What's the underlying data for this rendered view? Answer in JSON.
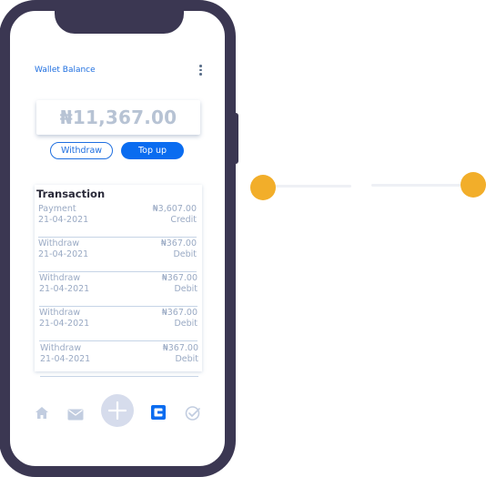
{
  "header": {
    "title": "Wallet Balance",
    "menu_icon": "kebab-menu-icon"
  },
  "balance": {
    "amount": "₦11,367.00"
  },
  "actions": {
    "withdraw_label": "Withdraw",
    "topup_label": "Top up"
  },
  "transactions": {
    "title": "Transaction",
    "items": [
      {
        "type": "Payment",
        "date": "21-04-2021",
        "amount": "₦3,607.00",
        "kind": "Credit"
      },
      {
        "type": "Withdraw",
        "date": "21-04-2021",
        "amount": "₦367.00",
        "kind": "Debit"
      },
      {
        "type": "Withdraw",
        "date": "21-04-2021",
        "amount": "₦367.00",
        "kind": "Debit"
      },
      {
        "type": "Withdraw",
        "date": "21-04-2021",
        "amount": "₦367.00",
        "kind": "Debit"
      },
      {
        "type": "Withdraw",
        "date": "21-04-2021",
        "amount": "₦367.00",
        "kind": "Debit"
      }
    ]
  },
  "tabbar": {
    "icons": [
      "home-icon",
      "mail-icon",
      "plus-icon",
      "wallet-icon",
      "check-badge-icon"
    ],
    "active": "wallet-icon"
  },
  "colors": {
    "accent": "#0a6cf0",
    "phone_frame": "#3b3752",
    "stepper": "#f2ae2a"
  }
}
